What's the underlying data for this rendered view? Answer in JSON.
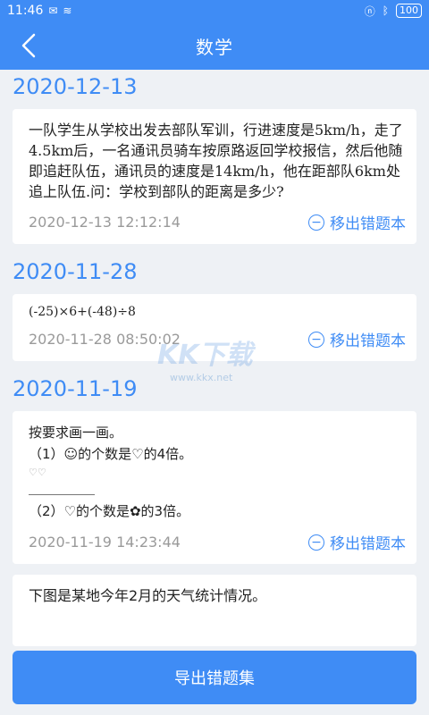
{
  "status_bar": {
    "time": "11:46",
    "battery": "100"
  },
  "app_bar": {
    "title": "数学"
  },
  "groups": [
    {
      "date": "2020-12-13",
      "question": "一队学生从学校出发去部队军训，行进速度是5km/h，走了4.5km后，一名通讯员骑车按原路返回学校报信，然后他随即追赶队伍，通讯员的速度是14km/h，他在距部队6km处追上队伍.问：学校到部队的距离是多少?",
      "timestamp": "2020-12-13 12:12:14",
      "remove_label": "移出错题本"
    },
    {
      "date": "2020-11-28",
      "question": "(-25)×6+(-48)÷8",
      "timestamp": "2020-11-28 08:50:02",
      "remove_label": "移出错题本"
    },
    {
      "date": "2020-11-19",
      "line1": "按要求画一画。",
      "line2": "（1）☺的个数是♡的4倍。",
      "hearts": "♡♡",
      "line3": "（2）♡的个数是✿的3倍。",
      "timestamp": "2020-11-19 14:23:44",
      "remove_label": "移出错题本"
    }
  ],
  "partial_card": {
    "text": "下图是某地今年2月的天气统计情况。"
  },
  "watermark": {
    "brand": "KK下载",
    "site": "www.kkx.net"
  },
  "export_button": "导出错题集",
  "colors": {
    "primary": "#3f8cf5",
    "background": "#eef1f5"
  }
}
